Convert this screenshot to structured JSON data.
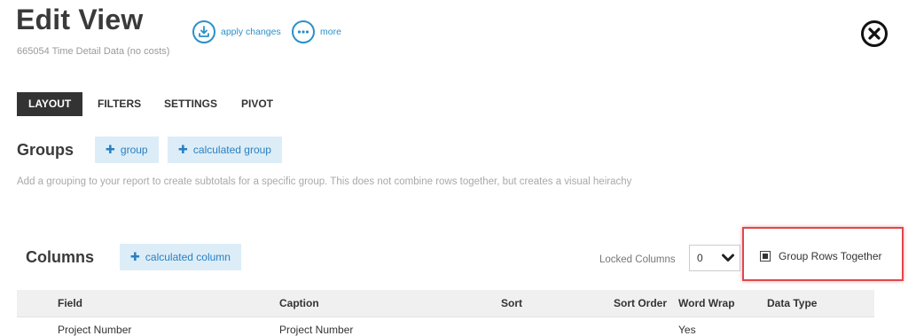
{
  "header": {
    "title": "Edit View",
    "subtitle": "665054 Time Detail Data (no costs)",
    "apply_label": "apply changes",
    "more_label": "more"
  },
  "tabs": [
    {
      "label": "LAYOUT",
      "active": true
    },
    {
      "label": "FILTERS",
      "active": false
    },
    {
      "label": "SETTINGS",
      "active": false
    },
    {
      "label": "PIVOT",
      "active": false
    }
  ],
  "groups": {
    "title": "Groups",
    "add_group_label": "group",
    "add_calc_group_label": "calculated group",
    "description": "Add a grouping to your report to create subtotals for a specific group. This does not combine rows together, but creates a visual heirachy"
  },
  "columns": {
    "title": "Columns",
    "add_calc_column_label": "calculated column",
    "locked_label": "Locked Columns",
    "locked_value": "0",
    "group_rows_label": "Group Rows Together",
    "group_rows_checked": true,
    "headers": [
      "Field",
      "Caption",
      "Sort",
      "Sort Order",
      "Word Wrap",
      "Data Type"
    ],
    "rows": [
      {
        "field": "Project Number",
        "caption": "Project Number",
        "sort": "",
        "sort_order": "",
        "word_wrap": "Yes",
        "data_type": ""
      }
    ]
  },
  "colors": {
    "accent": "#2b91c9",
    "tab_active_bg": "#333333",
    "highlight": "#e0474c",
    "button_bg": "#dcedf8"
  },
  "icons": [
    "download-icon",
    "more-dots-icon",
    "close-icon",
    "plus-icon",
    "chevron-down-icon"
  ]
}
